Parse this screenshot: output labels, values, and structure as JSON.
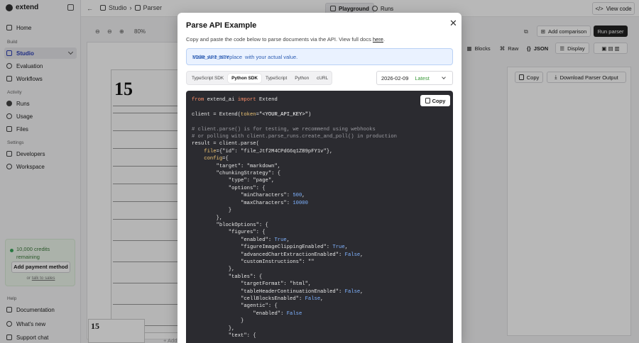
{
  "sidebar": {
    "brand": "extend",
    "sections": {
      "build": "Build",
      "activity": "Activity",
      "settings": "Settings",
      "help": "Help"
    },
    "items": [
      {
        "label": "Home"
      },
      {
        "label": "Studio"
      },
      {
        "label": "Evaluation"
      },
      {
        "label": "Workflows"
      },
      {
        "label": "Runs"
      },
      {
        "label": "Usage"
      },
      {
        "label": "Files"
      },
      {
        "label": "Developers"
      },
      {
        "label": "Workspace"
      },
      {
        "label": "Documentation"
      },
      {
        "label": "What's new"
      },
      {
        "label": "Support chat"
      }
    ],
    "credits": {
      "text": "10,000 credits remaining",
      "button": "Add payment method",
      "foot_prefix": "or",
      "foot_link": "talk to sales"
    }
  },
  "topbar": {
    "crumb_studio": "Studio",
    "crumb_parser": "Parser",
    "tab_playground": "Playground",
    "tab_runs": "Runs",
    "view_code": "View code"
  },
  "toolbar": {
    "zoom": "80%",
    "add_comparison": "Add comparison",
    "run_parser": "Run parser",
    "blocks": "Blocks",
    "raw": "Raw",
    "json": "JSON",
    "display": "Display",
    "copy": "Copy",
    "download": "Download Parser Output"
  },
  "document": {
    "big_number": "15",
    "thumb_number": "15",
    "add_hint": "+ Add"
  },
  "modal": {
    "title": "Parse API Example",
    "description_prefix": "Copy and paste the code below to parse documents via the API. View full docs",
    "description_link": "here",
    "description_suffix": ".",
    "info_prefix": "Make sure to replace",
    "info_code": "YOUR_API_KEY",
    "info_suffix": "with your actual value.",
    "tabs": [
      "TypeScript SDK",
      "Python SDK",
      "TypeScript",
      "Python",
      "cURL"
    ],
    "active_tab": "Python SDK",
    "version": "2026-02-09",
    "version_tag": "Latest",
    "copy_label": "Copy"
  },
  "code": {
    "l1_from": "from",
    "l1_mod": "extend_ai",
    "l1_import": "import",
    "l1_name": "Extend",
    "l2_a": "client",
    "l2_b": " = Extend(",
    "l2_arg": "token",
    "l2_eq": "=",
    "l2_str": "\"<YOUR_API_KEY>\"",
    "l2_end": ")",
    "l3": "# client.parse() is for testing, we recommend using webhooks",
    "l4": "# or polling with client.parse_runs.create_and_poll() in production",
    "l5": "result = client.parse(",
    "l6_arg": "file",
    "l6_rest": "={\"id\": \"file_Jtf2M4CPdG6q1ZB9pFY1v\"},",
    "l7_arg": "config",
    "l7_rest": "={",
    "l8": "\"target\": \"markdown\",",
    "l9": "\"chunkingStrategy\": {",
    "l10": "\"type\": \"page\",",
    "l11": "\"options\": {",
    "l12_k": "\"minCharacters\": ",
    "l12_v": "500",
    "l12_c": ",",
    "l13_k": "\"maxCharacters\": ",
    "l13_v": "10000",
    "l14": "}",
    "l15": "},",
    "l16": "\"blockOptions\": {",
    "l17": "\"figures\": {",
    "l18_k": "\"enabled\": ",
    "l18_v": "True",
    "l18_c": ",",
    "l19_k": "\"figureImageClippingEnabled\": ",
    "l19_v": "True",
    "l19_c": ",",
    "l20_k": "\"advancedChartExtractionEnabled\": ",
    "l20_v": "False",
    "l20_c": ",",
    "l21": "\"customInstructions\": \"\"",
    "l22": "},",
    "l23": "\"tables\": {",
    "l24": "\"targetFormat\": \"html\",",
    "l25_k": "\"tableHeaderContinuationEnabled\": ",
    "l25_v": "False",
    "l25_c": ",",
    "l26_k": "\"cellBlocksEnabled\": ",
    "l26_v": "False",
    "l26_c": ",",
    "l27": "\"agentic\": {",
    "l28_k": "\"enabled\": ",
    "l28_v": "False",
    "l29": "}",
    "l30": "},",
    "l31": "\"text\": {"
  }
}
